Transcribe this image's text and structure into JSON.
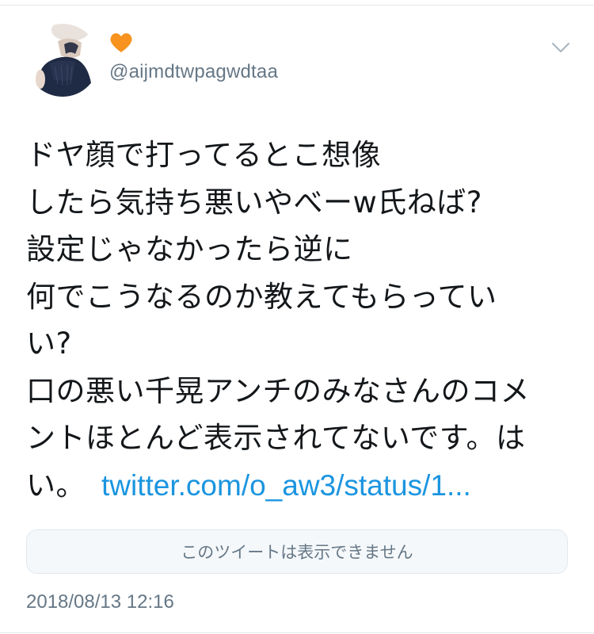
{
  "tweet": {
    "display_name_icon": "orange-heart-icon",
    "handle": "@aijmdtwpagwdtaa",
    "text_lines": [
      "ドヤ顔で打ってるとこ想像",
      "したら気持ち悪いやべーw氏ねば?",
      "設定じゃなかったら逆に",
      "何でこうなるのか教えてもらってい",
      "い?",
      "口の悪い千晃アンチのみなさんのコメ",
      "ントほとんど表示されてないです。は",
      "い。"
    ],
    "link_text": "twitter.com/o_aw3/status/1...",
    "quoted_unavailable": "このツイートは表示できません",
    "timestamp": "2018/08/13 12:16"
  },
  "colors": {
    "link": "#1b95e0",
    "secondary_text": "#657786",
    "heart": "#f7931e",
    "avatar_dress": "#1f2a44"
  },
  "icons": {
    "menu": "chevron-down-icon",
    "avatar": "avatar"
  }
}
